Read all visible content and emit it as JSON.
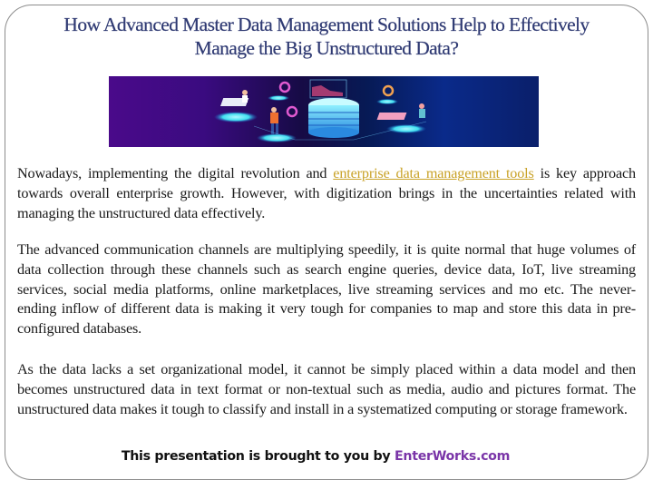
{
  "slide": {
    "title_line1": "How Advanced Master Data Management Solutions Help to Effectively",
    "title_line2": "Manage the Big Unstructured Data?",
    "banner": {
      "description": "Isometric illustration of people working around a glowing database stack with floating charts",
      "colors": {
        "left": "#4a0a8a",
        "right": "#0a2a8a",
        "glow": "#41e0f0"
      }
    },
    "paragraphs": [
      {
        "before_link": "Nowadays, implementing the digital revolution and ",
        "link_text": "enterprise data management tools",
        "after_link": " is key approach towards overall enterprise growth. However, with digitization brings in the uncertainties related with managing the unstructured data effectively."
      },
      {
        "text": "The advanced communication channels are multiplying speedily, it is quite normal that huge volumes of  data collection through these channels such as search engine queries, device data, IoT, live streaming services, social media platforms, online marketplaces, live streaming services and mo etc. The never-ending inflow of  different data is making it very tough for companies to map and store this data in pre-configured databases."
      },
      {
        "text": "As the data lacks a set organizational model, it cannot be simply placed within a data model and then becomes unstructured data in text format or non-textual such as media, audio and pictures format. The unstructured data makes it tough to classify and install in a systematized computing or storage framework."
      }
    ],
    "footer": {
      "prefix": "This presentation is brought to you by ",
      "brand": "EnterWorks.com"
    },
    "colors": {
      "title": "#2f3a73",
      "link": "#c9a227",
      "brand": "#7a35a8",
      "frame_border": "#8c8c8c"
    }
  }
}
